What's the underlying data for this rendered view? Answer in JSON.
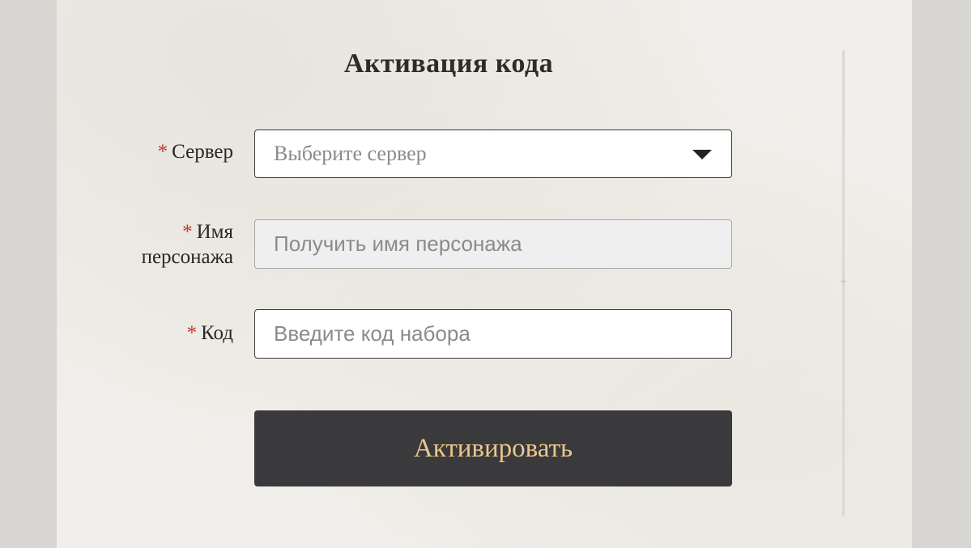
{
  "form": {
    "title": "Активация кода",
    "required_mark": "*",
    "server": {
      "label": "Сервер",
      "placeholder": "Выберите сервер",
      "icon": "triangle-down-icon"
    },
    "character": {
      "label_line1": "Имя",
      "label_line2": "персонажа",
      "placeholder": "Получить имя персонажа"
    },
    "code": {
      "label": "Код",
      "placeholder": "Введите код набора"
    },
    "submit_label": "Активировать"
  },
  "colors": {
    "background": "#f1efeb",
    "button": "#3a3a3d",
    "button_text": "#ecc78b",
    "required": "#c0392b"
  }
}
